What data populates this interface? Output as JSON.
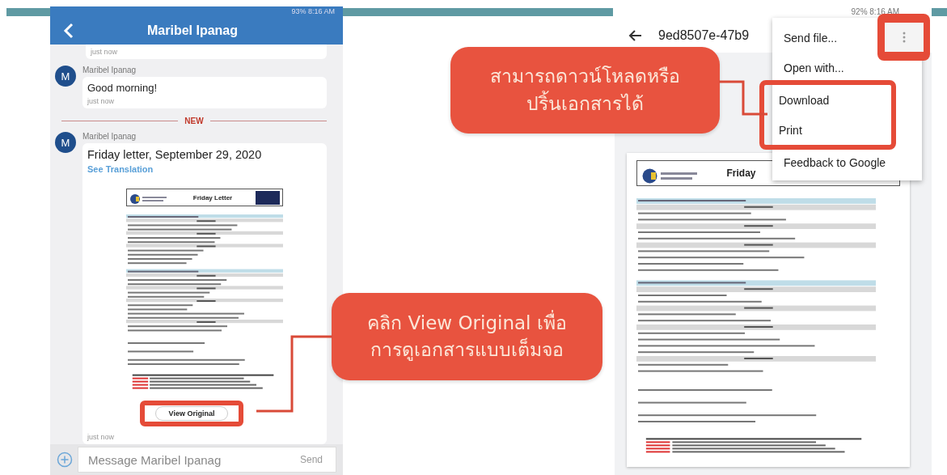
{
  "chat_screen": {
    "status_bar": "93% 8:16 AM",
    "title": "Maribel Ipanag",
    "messages": [
      {
        "kind": "time",
        "time": "just now"
      },
      {
        "kind": "message",
        "avatar": "M",
        "sender": "Maribel Ipanag",
        "text": "Good morning!",
        "time": "just now"
      },
      {
        "kind": "divider",
        "label": "NEW"
      },
      {
        "kind": "attachment",
        "avatar": "M",
        "sender": "Maribel Ipanag",
        "text": "Friday letter, September 29, 2020",
        "link": "See Translation",
        "document_title": "Friday Letter",
        "button": "View Original",
        "highlighted": true,
        "time": "just now"
      }
    ],
    "composer": {
      "placeholder": "Message Maribel Ipanag",
      "send": "Send"
    }
  },
  "viewer_screen": {
    "status_bar": "92% 8:16 AM",
    "title": "9ed8507e-47b9",
    "document_title": "Friday",
    "menu_button_highlighted": true,
    "menu": [
      {
        "label": "Send file...",
        "highlighted": false
      },
      {
        "label": "Open with...",
        "highlighted": false
      },
      {
        "label": "Download",
        "highlighted": true
      },
      {
        "label": "Print",
        "highlighted": true
      },
      {
        "label": "Feedback to Google",
        "highlighted": false
      }
    ]
  },
  "callouts": [
    {
      "text": "สามารถดาวน์โหลดหรือ\nปริ้นเอกสารได้"
    },
    {
      "text": "คลิก View Original เพื่อ\nการดูเอกสารแบบเต็มจอ"
    }
  ]
}
